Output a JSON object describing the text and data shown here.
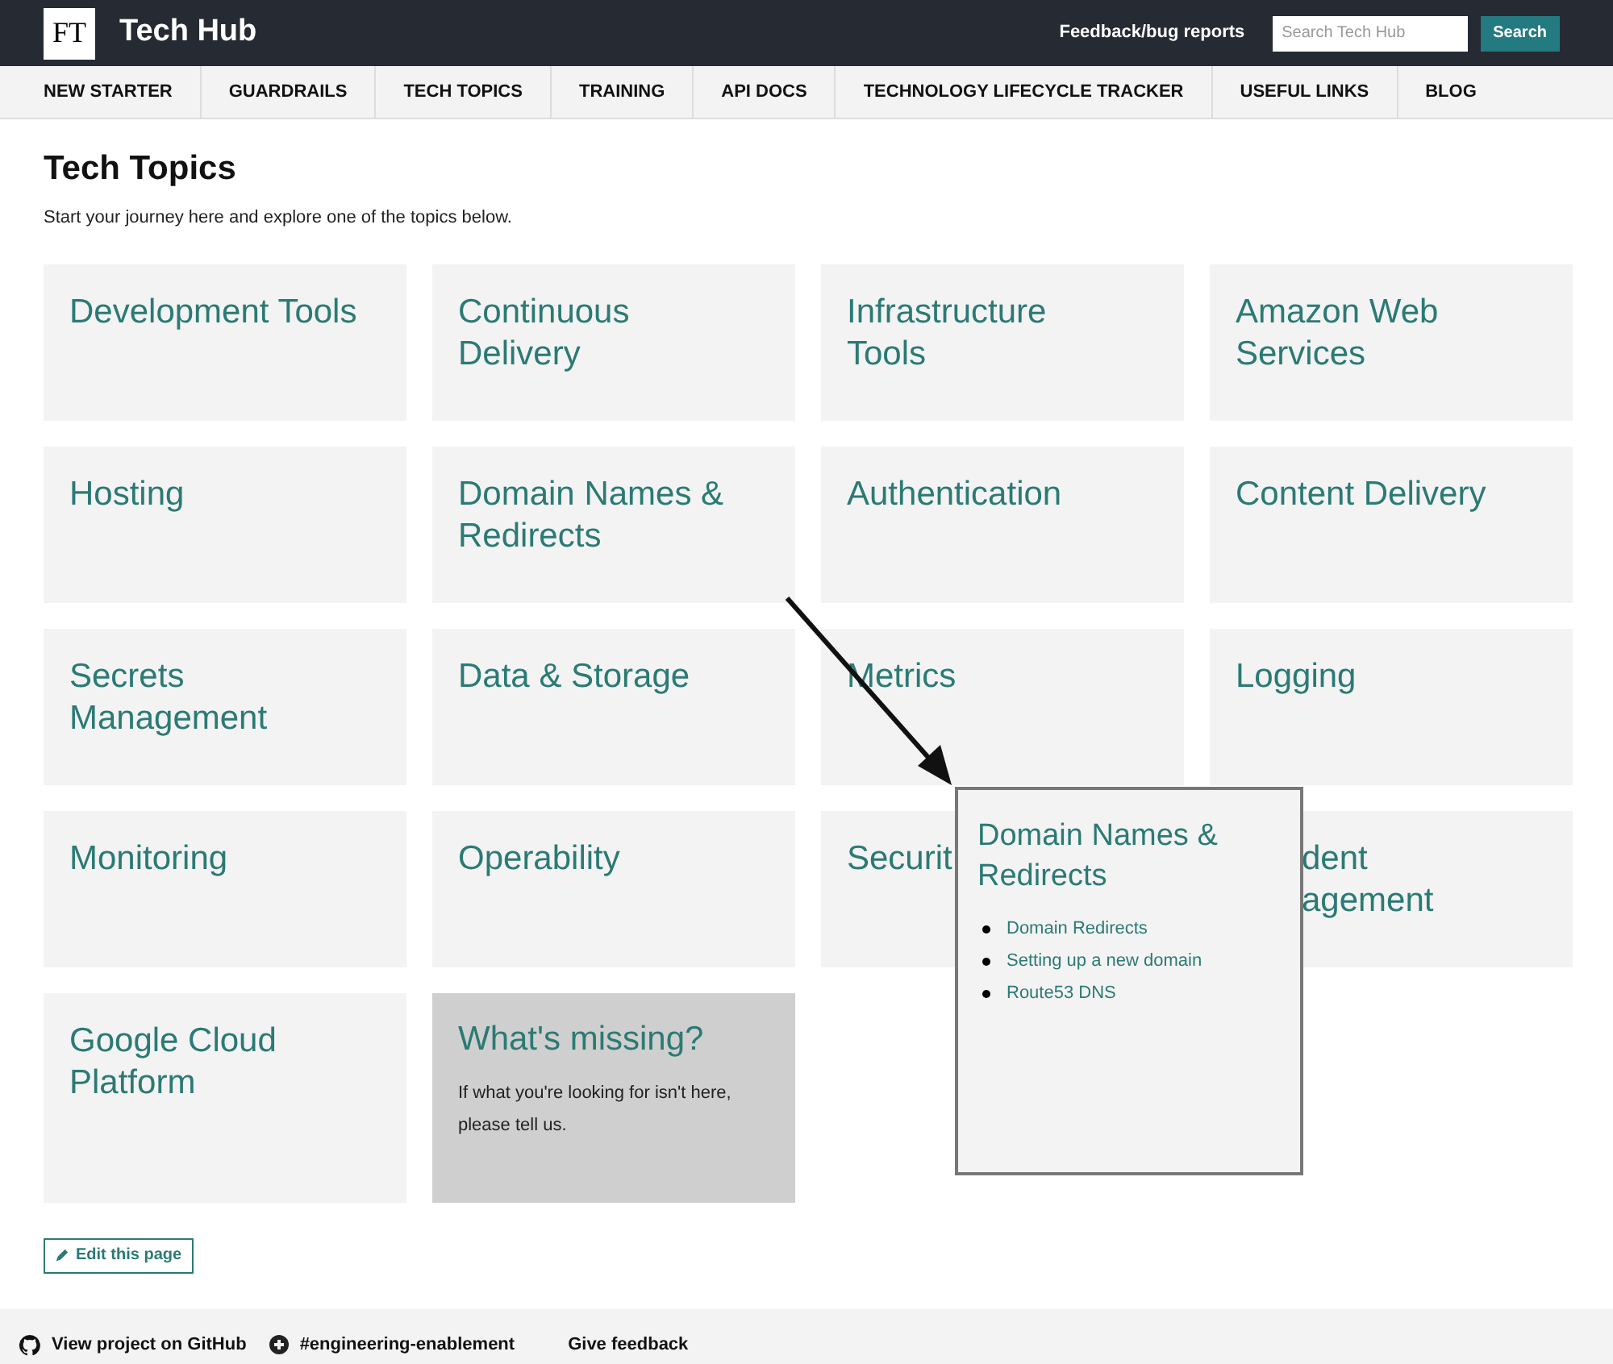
{
  "header": {
    "logo": "FT",
    "title": "Tech Hub",
    "feedback_link": "Feedback/bug reports",
    "search": {
      "placeholder": "Search Tech Hub"
    },
    "search_button": "Search"
  },
  "nav": [
    "NEW STARTER",
    "GUARDRAILS",
    "TECH TOPICS",
    "TRAINING",
    "API DOCS",
    "TECHNOLOGY LIFECYCLE TRACKER",
    "USEFUL LINKS",
    "BLOG"
  ],
  "page": {
    "title": "Tech Topics",
    "intro": "Start your journey here and explore one of the topics below."
  },
  "tiles": [
    {
      "kind": "topic",
      "title_lines": [
        "Development Tools"
      ]
    },
    {
      "kind": "topic",
      "title_lines": [
        "Continuous",
        "Delivery"
      ]
    },
    {
      "kind": "topic",
      "title_lines": [
        "Infrastructure",
        "Tools"
      ]
    },
    {
      "kind": "topic",
      "title_lines": [
        "Amazon Web",
        "Services"
      ]
    },
    {
      "kind": "topic",
      "title_lines": [
        "Hosting"
      ]
    },
    {
      "kind": "topic",
      "title_lines": [
        "Domain Names &",
        "Redirects"
      ]
    },
    {
      "kind": "topic",
      "title_lines": [
        "Authentication"
      ]
    },
    {
      "kind": "topic",
      "title_lines": [
        "Content Delivery"
      ]
    },
    {
      "kind": "topic",
      "title_lines": [
        "Secrets",
        "Management"
      ]
    },
    {
      "kind": "topic",
      "title_lines": [
        "Data & Storage"
      ]
    },
    {
      "kind": "topic",
      "title_lines": [
        "Metrics"
      ]
    },
    {
      "kind": "topic",
      "title_lines": [
        "Logging"
      ]
    },
    {
      "kind": "topic",
      "title_lines": [
        "Monitoring"
      ]
    },
    {
      "kind": "topic",
      "title_lines": [
        "Operability"
      ]
    },
    {
      "kind": "topic",
      "title_lines": [
        "Securit"
      ]
    },
    {
      "kind": "covered",
      "title_lines": [
        "dent",
        "agement"
      ]
    },
    {
      "kind": "topic",
      "title_lines": [
        "Google Cloud",
        "Platform"
      ]
    },
    {
      "kind": "missing",
      "title_lines": [
        "What's missing?"
      ],
      "text": "If what you're looking for isn't here, please tell us."
    }
  ],
  "popup": {
    "title_lines": [
      "Domain Names &",
      "Redirects"
    ],
    "links": [
      "Domain Redirects",
      "Setting up a new domain",
      "Route53 DNS"
    ]
  },
  "edit_button": "Edit this page",
  "footer": {
    "github_link": "View project on GitHub",
    "slack_link": "#engineering-enablement",
    "feedback_link": "Give feedback"
  }
}
